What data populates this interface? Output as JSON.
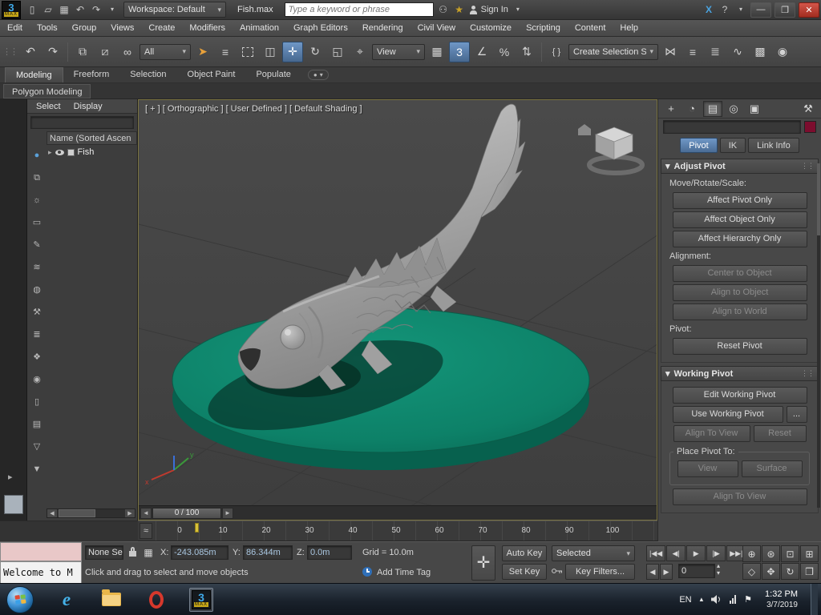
{
  "colors": {
    "accent_blue": "#4f7cba",
    "teal_base": "#0d8a6f",
    "close_red": "#c23b2b",
    "listener_pink": "#e9c8c8"
  },
  "logo": {
    "three": "3",
    "max": "MAX"
  },
  "titlebar": {
    "workspace": "Workspace: Default",
    "filename": "Fish.max",
    "search_placeholder": "Type a keyword or phrase",
    "signin": "Sign In"
  },
  "menubar": {
    "items": [
      "Edit",
      "Tools",
      "Group",
      "Views",
      "Create",
      "Modifiers",
      "Animation",
      "Graph Editors",
      "Rendering",
      "Civil View",
      "Customize",
      "Scripting",
      "Content",
      "Help"
    ]
  },
  "toolbar": {
    "filter": "All",
    "view": "View",
    "selection_set": "Create Selection Se"
  },
  "ribbon": {
    "tabs": [
      "Modeling",
      "Freeform",
      "Selection",
      "Object Paint",
      "Populate"
    ],
    "panel_tab": "Polygon Modeling"
  },
  "explorer": {
    "menu_select": "Select",
    "menu_display": "Display",
    "header": "Name (Sorted Ascen",
    "item_fish": "Fish"
  },
  "viewport": {
    "annotation": "[ + ] [ Orthographic ] [ User Defined ] [ Default Shading ]"
  },
  "command_panel": {
    "pivot": "Pivot",
    "ik": "IK",
    "link_info": "Link Info",
    "ap_title": "Adjust Pivot",
    "ap_mrs": "Move/Rotate/Scale:",
    "ap_b1": "Affect Pivot Only",
    "ap_b2": "Affect Object Only",
    "ap_b3": "Affect Hierarchy Only",
    "ap_align": "Alignment:",
    "ap_b4": "Center to Object",
    "ap_b5": "Align to Object",
    "ap_b6": "Align to World",
    "ap_piv": "Pivot:",
    "ap_b7": "Reset Pivot",
    "wp_title": "Working Pivot",
    "wp_b1": "Edit Working Pivot",
    "wp_b2": "Use Working Pivot",
    "wp_more": "...",
    "wp_b3": "Align To View",
    "wp_b4": "Reset",
    "wp_place": "Place Pivot To:",
    "wp_b5": "View",
    "wp_b6": "Surface",
    "wp_b7": "Align To View"
  },
  "timeline": {
    "frame": "0 / 100",
    "ticks": [
      "0",
      "10",
      "20",
      "30",
      "40",
      "50",
      "60",
      "70",
      "80",
      "90",
      "100"
    ]
  },
  "statusbar": {
    "none_sel": "None Se",
    "x_label": "X:",
    "x": "-243.085m",
    "y_label": "Y:",
    "y": "86.344m",
    "z_label": "Z:",
    "z": "0.0m",
    "grid": "Grid = 10.0m",
    "prompt": "Click and drag to select and move objects",
    "add_time_tag": "Add Time Tag",
    "auto_key": "Auto Key",
    "set_key": "Set Key",
    "selected": "Selected",
    "key_filters": "Key Filters...",
    "frame": "0"
  },
  "listener": {
    "text": "Welcome to M"
  },
  "taskbar": {
    "lang": "EN",
    "time": "1:32 PM",
    "date": "3/7/2019"
  },
  "icons": {
    "grip": "⋮⋮",
    "new": "▯",
    "open": "▱",
    "save": "▦",
    "dd": "▾",
    "undo": "↶",
    "redo": "↷",
    "link": "⧉",
    "unlink": "⧄",
    "bind": "∞",
    "cursor": "➤",
    "byname": "≡",
    "windowcross": "◫",
    "move": "✛",
    "rotate": "↻",
    "scale": "◱",
    "place": "⌖",
    "snap3": "3",
    "anglesnap": "∠",
    "percentsnap": "%",
    "spinnersnap": "⇅",
    "editsets": "{ }",
    "mirror": "⋈",
    "align": "≡",
    "layers": "≣",
    "curve": "∿",
    "rendersetup": "▩",
    "render": "◉",
    "binoculars": "⚇",
    "star": "★",
    "comm": "X",
    "question": "?",
    "min": "—",
    "max": "❐",
    "close": "✕",
    "pill_dot": "●",
    "create": "+",
    "modify": "◔",
    "hierarchy": "▤",
    "motion": "◎",
    "display_tab": "▣",
    "utilities": "⚒",
    "explorer_tools": [
      "●",
      "⧉",
      "☼",
      "▭",
      "✎",
      "≋",
      "◍",
      "⚒",
      "≣",
      "❖",
      "◉",
      "▯",
      "▤",
      "▽",
      "▼"
    ],
    "tri_right": "▸",
    "tri_down": "▾",
    "slider_left": "◄",
    "slider_right": "►",
    "pb_start": "|◀◀",
    "pb_prev": "◀|",
    "pb_play": "▶",
    "pb_next": "|▶",
    "pb_end": "▶▶|",
    "arrow_left": "◀",
    "arrow_right": "▶",
    "spin_up": "▴",
    "spin_down": "▾",
    "nav_zoom": "⊕",
    "nav_zoomall": "⊛",
    "nav_extents": "⊡",
    "nav_region": "⊞",
    "nav_fov": "◇",
    "nav_pan": "✥",
    "nav_orbit": "↻",
    "nav_max": "❒",
    "gridmode": "▦",
    "bigmove": "✛",
    "mini_curve": "≈",
    "tray_caret": "▴",
    "tray_flag": "⚑"
  }
}
